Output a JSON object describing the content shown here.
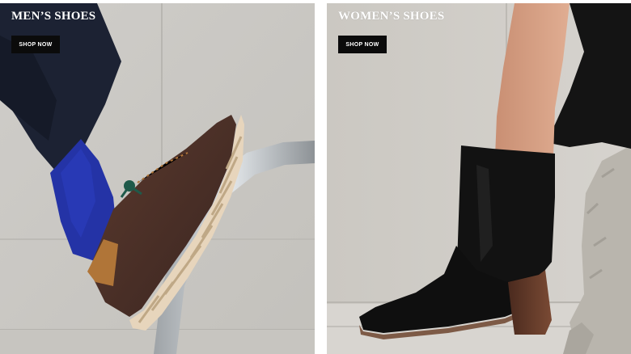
{
  "promos": [
    {
      "title": "MEN’S SHOES",
      "cta": "SHOP NOW"
    },
    {
      "title": "WOMEN’S SHOES",
      "cta": "SHOP NOW"
    }
  ],
  "colors": {
    "button_bg": "#0b0b0b",
    "button_text": "#ffffff",
    "title_text": "#ffffff"
  }
}
